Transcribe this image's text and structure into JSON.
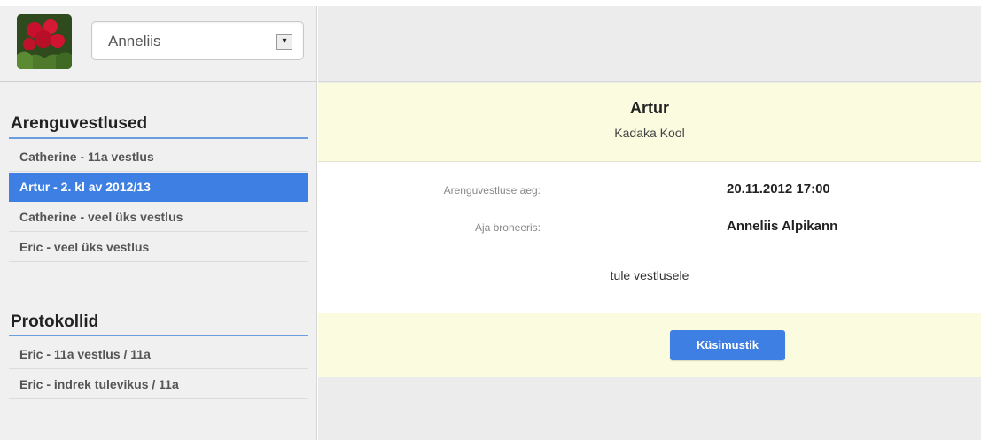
{
  "user_select": {
    "value": "Anneliis"
  },
  "sidebar": {
    "sections": [
      {
        "title": "Arenguvestlused",
        "items": [
          {
            "label": "Catherine - 11a vestlus",
            "active": false
          },
          {
            "label": "Artur - 2. kl av 2012/13",
            "active": true
          },
          {
            "label": "Catherine - veel üks vestlus",
            "active": false
          },
          {
            "label": "Eric - veel üks vestlus",
            "active": false
          }
        ]
      },
      {
        "title": "Protokollid",
        "items": [
          {
            "label": "Eric - 11a vestlus / 11a",
            "active": false
          },
          {
            "label": "Eric - indrek tulevikus / 11a",
            "active": false
          }
        ]
      }
    ]
  },
  "detail": {
    "name": "Artur",
    "school": "Kadaka Kool",
    "time_label": "Arenguvestluse aeg:",
    "time_value": "20.11.2012 17:00",
    "booker_label": "Aja broneeris:",
    "booker_value": "Anneliis Alpikann",
    "message": "tule vestlusele",
    "button_label": "Küsimustik"
  },
  "colors": {
    "accent": "#3d7fe2",
    "highlight_panel": "#fbfbe0",
    "sidebar_bg": "#f0f0f0"
  }
}
